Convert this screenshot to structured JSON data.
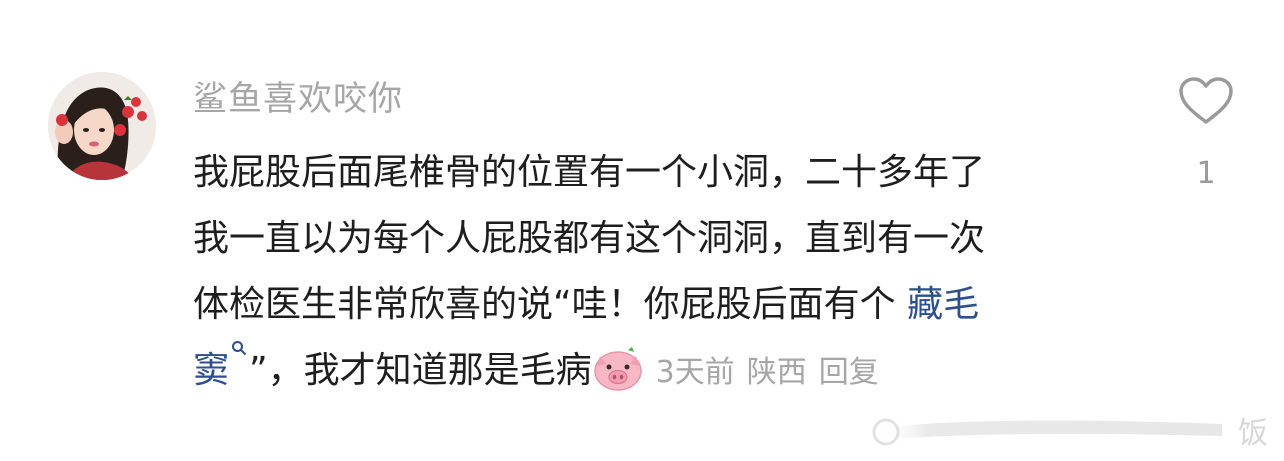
{
  "comment": {
    "username": "鲨鱼喜欢咬你",
    "lines": [
      "我屁股后面尾椎骨的位置有一个小洞，二十多年了",
      "我一直以为每个人屁股都有这个洞洞，直到有一次",
      "体检医生非常欣喜的说“哇！你屁股后面有个 "
    ],
    "link_part1": "藏毛",
    "link_part2": "窦",
    "line4_text": "”，我才知道那是毛病",
    "emoji_name": "pig-face-emoji",
    "time": "3天前",
    "location": "陕西",
    "reply_label": "回复"
  },
  "like": {
    "count": "1",
    "icon": "heart-outline-icon"
  },
  "watermark": {
    "text": "饭"
  },
  "colors": {
    "username": "#a6a6a6",
    "body_text": "#1e1e1e",
    "link": "#2d4f8f",
    "meta": "#a6a6a6"
  }
}
